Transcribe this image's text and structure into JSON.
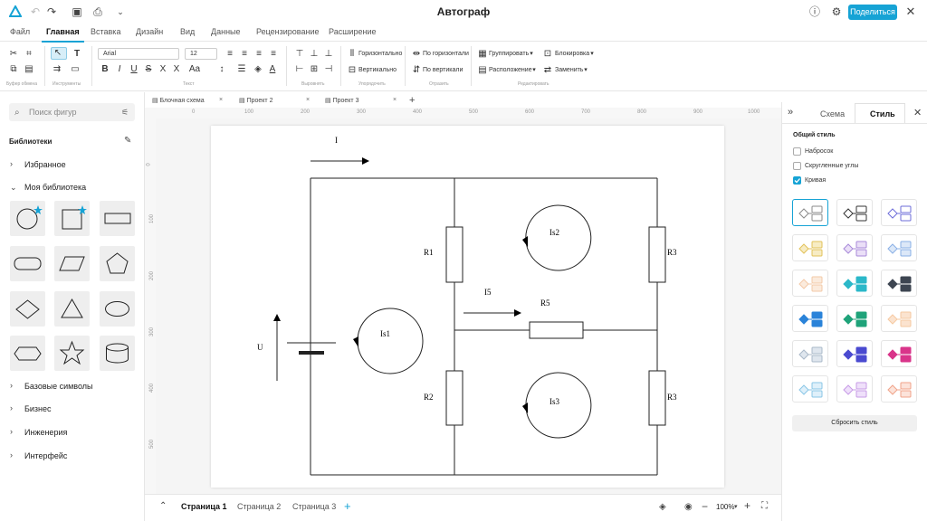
{
  "app": {
    "title": "Автограф",
    "share_label": "Поделиться"
  },
  "menu_tabs": [
    "Файл",
    "Главная",
    "Вставка",
    "Дизайн",
    "Вид",
    "Данные",
    "Рецензирование",
    "Расширение"
  ],
  "ribbon": {
    "font_name": "Arial",
    "font_size": "12",
    "align_horizontal": "Горизонтально",
    "align_vertical": "Вертикально",
    "dist_horizontal": "По горизонтали",
    "dist_vertical": "По вертикали",
    "group": "Группировать",
    "lock": "Блокировка",
    "arrange": "Расположение",
    "replace": "Заменить",
    "groups": [
      "Буфер обмена",
      "Инструменты",
      "Текст",
      "Выровнять",
      "Упорядочить",
      "Отразить",
      "Редактировать"
    ]
  },
  "left_panel": {
    "search_placeholder": "Поиск фигур",
    "libraries_title": "Библиотеки",
    "favorites": "Избранное",
    "my_library": "Моя библиотека",
    "basic_symbols": "Базовые символы",
    "business": "Бизнес",
    "engineering": "Инженерия",
    "interface": "Интерфейс"
  },
  "doc_tabs": [
    "Блочная схема",
    "Проект 2",
    "Проект 3"
  ],
  "ruler_h": [
    "0",
    "100",
    "200",
    "300",
    "400",
    "500",
    "600",
    "700",
    "800",
    "900",
    "1000"
  ],
  "ruler_v": [
    "0",
    "100",
    "200",
    "300",
    "400",
    "500"
  ],
  "diagram": {
    "labels": {
      "I": "I",
      "U": "U",
      "R1": "R1",
      "R2": "R2",
      "R3": "R3",
      "R5": "R5",
      "I5": "I5",
      "Is1": "Is1",
      "Is2": "Is2",
      "Is3": "Is3"
    }
  },
  "pages": [
    "Страница 1",
    "Страница 2",
    "Страница 3"
  ],
  "zoom": "100%",
  "right_panel": {
    "tab_schema": "Схема",
    "tab_style": "Стиль",
    "general_style": "Общий стиль",
    "opt_sketch": "Набросок",
    "opt_rounded": "Скругленные углы",
    "opt_curve": "Кривая",
    "curve_checked": true,
    "reset_label": "Сбросить стиль"
  },
  "colors": {
    "accent": "#16a3d5"
  }
}
